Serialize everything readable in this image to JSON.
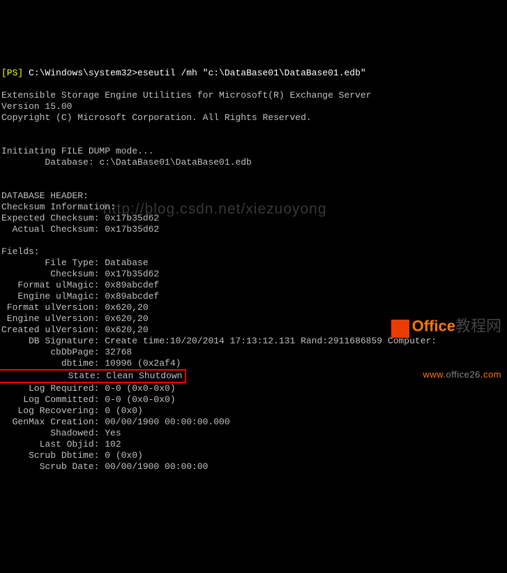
{
  "prompt": {
    "prefix": "[PS] ",
    "path": "C:\\Windows\\system32>",
    "command": "eseutil /mh \"c:\\DataBase01\\DataBase01.edb\""
  },
  "header": {
    "line1": "Extensible Storage Engine Utilities for Microsoft(R) Exchange Server",
    "line2": "Version 15.00",
    "line3": "Copyright (C) Microsoft Corporation. All Rights Reserved."
  },
  "init": {
    "line1": "Initiating FILE DUMP mode...",
    "line2": "        Database: c:\\DataBase01\\DataBase01.edb"
  },
  "sections": {
    "db_header": "DATABASE HEADER:",
    "checksum_info": "Checksum Information:",
    "expected_checksum": "Expected Checksum: 0x17b35d62",
    "actual_checksum": "  Actual Checksum: 0x17b35d62",
    "fields": "Fields:"
  },
  "fields": {
    "file_type": "        File Type: Database",
    "checksum": "         Checksum: 0x17b35d62",
    "format_ulmagic": "   Format ulMagic: 0x89abcdef",
    "engine_ulmagic": "   Engine ulMagic: 0x89abcdef",
    "format_ulversion": " Format ulVersion: 0x620,20",
    "engine_ulversion": " Engine ulVersion: 0x620,20",
    "created_ulversion": "Created ulVersion: 0x620,20",
    "db_signature": "     DB Signature: Create time:10/20/2014 17:13:12.131 Rand:2911686859 Computer:",
    "cbdbpage": "         cbDbPage: 32768",
    "dbtime": "           dbtime: 10996 (0x2af4)",
    "state_label": "            State:",
    "state_value": "Clean Shutdown",
    "log_required": "     Log Required: 0-0 (0x0-0x0)",
    "log_committed": "    Log Committed: 0-0 (0x0-0x0)",
    "log_recovering": "   Log Recovering: 0 (0x0)",
    "genmax_creation": "  GenMax Creation: 00/00/1900 00:00:00.000",
    "shadowed": "         Shadowed: Yes",
    "last_objid": "       Last Objid: 102",
    "scrub_dbtime": "     Scrub Dbtime: 0 (0x0)",
    "scrub_date": "       Scrub Date: 00/00/1900 00:00:00"
  },
  "watermark": "http://blog.csdn.net/xiezuoyong",
  "site": {
    "brand_en": "Office",
    "brand_cn": "教程网",
    "url_prefix": "www.",
    "url_domain": "office26",
    "url_tld": ".com"
  }
}
